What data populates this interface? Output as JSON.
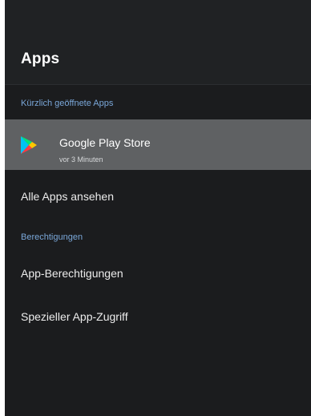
{
  "header": {
    "title": "Apps"
  },
  "recent_section": {
    "label": "Kürzlich geöffnete Apps",
    "apps": [
      {
        "name": "Google Play Store",
        "subtitle": "vor 3 Minuten",
        "icon": "google-play-store-icon"
      }
    ]
  },
  "menu": {
    "see_all_apps": "Alle Apps ansehen"
  },
  "permissions_section": {
    "label": "Berechtigungen",
    "items": [
      "App-Berechtigungen",
      "Spezieller App-Zugriff"
    ]
  },
  "colors": {
    "accent": "#7aa7d9",
    "selected_row": "#5f6163",
    "background": "#1b1c1e"
  }
}
